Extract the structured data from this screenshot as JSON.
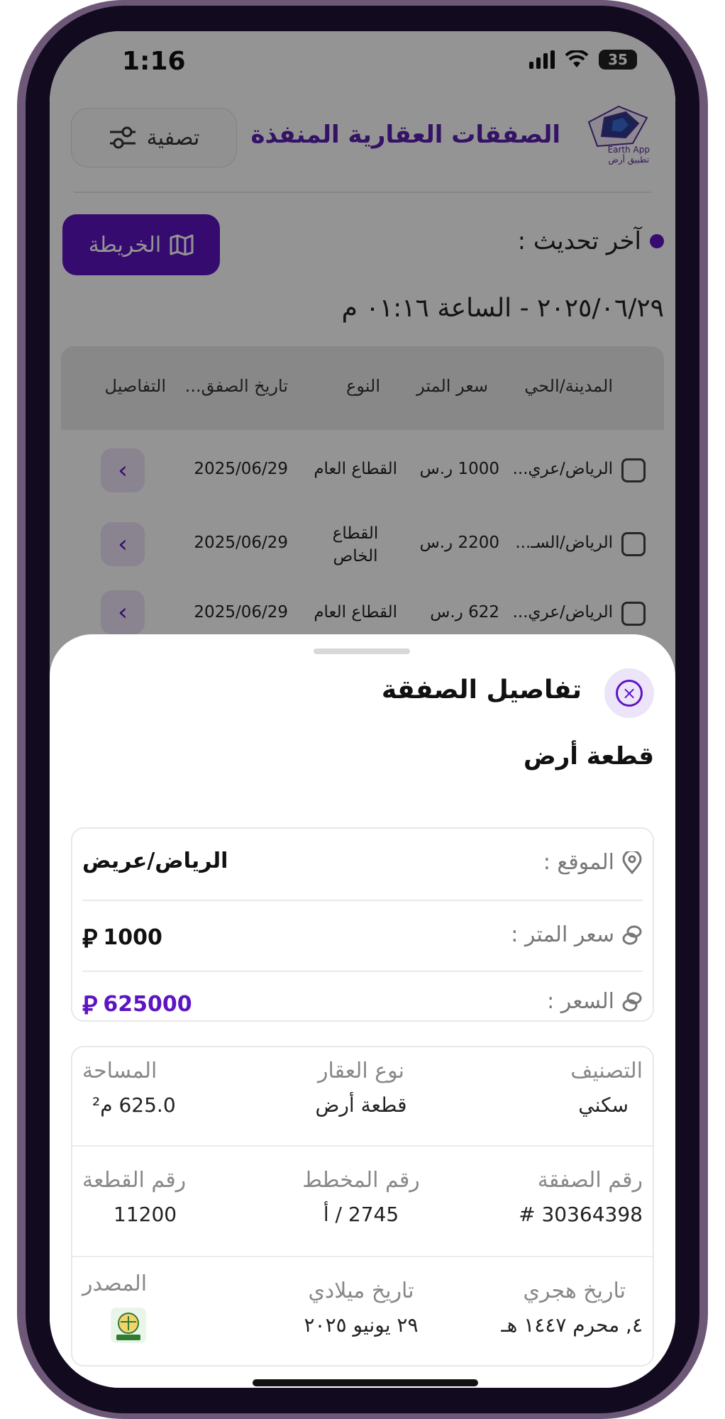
{
  "status_bar": {
    "time": "1:16",
    "battery": "35"
  },
  "header": {
    "title": "الصفقات العقارية المنفذة",
    "filter_label": "تصفية",
    "logo_caption_en": "Earth App",
    "logo_caption_ar": "تطبيق أرض"
  },
  "toolbar": {
    "map_label": "الخريطة",
    "last_update_label": "آخر تحديث :",
    "last_update_value": "٢٠٢٥/٠٦/٢٩ - الساعة ٠١:١٦ م"
  },
  "table": {
    "columns": [
      "المدينة/الحي",
      "سعر المتر",
      "النوع",
      "تاريخ الصفق...",
      "التفاصيل"
    ],
    "rows": [
      {
        "city": "الرياض/عري...",
        "price": "1000 ر.س",
        "type": "القطاع العام",
        "date": "2025/06/29"
      },
      {
        "city": "الرياض/السـ...",
        "price": "2200 ر.س",
        "type": "القطاع الخاص",
        "date": "2025/06/29"
      },
      {
        "city": "الرياض/عري...",
        "price": "622 ر.س",
        "type": "القطاع العام",
        "date": "2025/06/29"
      }
    ]
  },
  "sheet": {
    "title": "تفاصيل الصفقة",
    "subtitle": "قطعة أرض",
    "location_label": "الموقع :",
    "location_value": "الرياض/عريض",
    "meter_price_label": "سعر المتر :",
    "meter_price_value": "1000",
    "price_label": "السعر :",
    "price_value": "625000",
    "currency_symbol": "⃁",
    "classification_label": "التصنيف",
    "classification_value": "سكني",
    "property_type_label": "نوع العقار",
    "property_type_value": "قطعة أرض",
    "area_label": "المساحة",
    "area_value": "625.0 م²",
    "deal_number_label": "رقم الصفقة",
    "deal_number_value": "30364398 #",
    "plan_number_label": "رقم المخطط",
    "plan_number_value": "2745 / أ",
    "plot_number_label": "رقم القطعة",
    "plot_number_value": "11200",
    "hijri_label": "تاريخ هجري",
    "hijri_value": "٤, محرم ١٤٤٧ هـ",
    "gregorian_label": "تاريخ ميلادي",
    "gregorian_value": "٢٩ يونيو ٢٠٢٥",
    "source_label": "المصدر"
  },
  "colors": {
    "accent": "#5d14c2",
    "accent_light": "#ece4f8"
  }
}
